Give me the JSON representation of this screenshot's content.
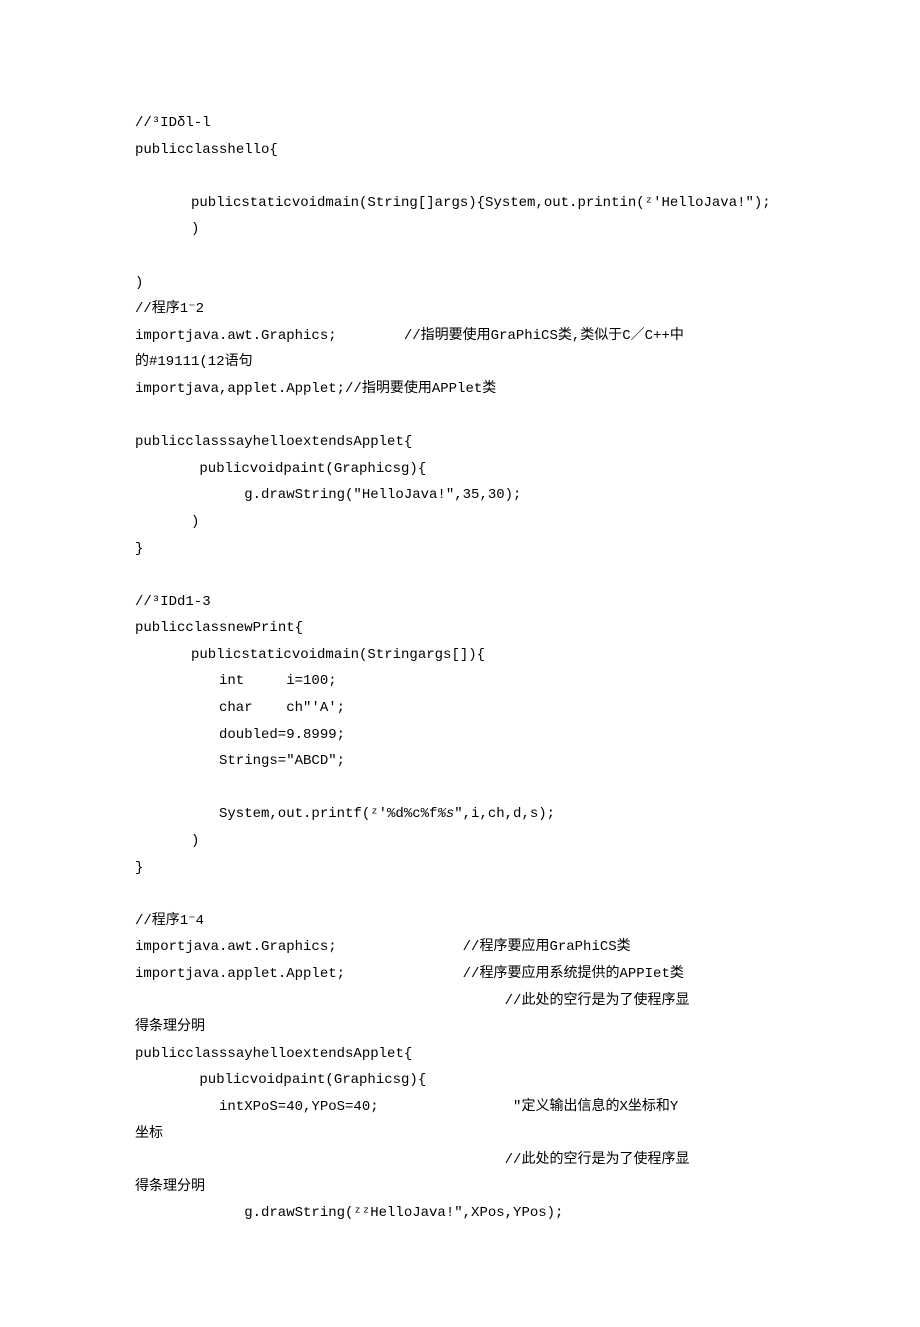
{
  "lines": [
    {
      "cls": "code-line",
      "text": "//³IDδl-l"
    },
    {
      "cls": "code-line",
      "text": "publicclasshello{"
    },
    {
      "cls": "code-line",
      "text": " "
    },
    {
      "cls": "code-line indent1",
      "text": "publicstaticvoidmain(String[]args){System,out.printin(ᶻ'HelloJava!″);"
    },
    {
      "cls": "code-line indent1",
      "text": ")"
    },
    {
      "cls": "code-line",
      "text": " "
    },
    {
      "cls": "code-line",
      "text": ")"
    },
    {
      "cls": "code-line",
      "text": "//程序1⁻2"
    },
    {
      "cls": "code-line",
      "text": "importjava.awt.Graphics;        //指明要使用GraPhiCS类,类似于C／C++中"
    },
    {
      "cls": "code-line",
      "text": "的#19111(12语句"
    },
    {
      "cls": "code-line",
      "text": "importjava,applet.Applet;//指明要使用APPlet类"
    },
    {
      "cls": "code-line",
      "text": " "
    },
    {
      "cls": "code-line",
      "text": "publicclasssayhelloextendsApplet{"
    },
    {
      "cls": "code-line indent1",
      "text": " publicvoidpaint(Graphicsg){"
    },
    {
      "cls": "code-line indent2",
      "text": "   g.drawString(″HelloJava!″,35,30);"
    },
    {
      "cls": "code-line indent1",
      "text": ")"
    },
    {
      "cls": "code-line",
      "text": "}"
    },
    {
      "cls": "code-line",
      "text": " "
    },
    {
      "cls": "code-line",
      "text": "//³IDd1-3"
    },
    {
      "cls": "code-line",
      "text": "publicclassnewPrint{"
    },
    {
      "cls": "code-line indent1",
      "text": "publicstaticvoidmain(Stringargs[]){"
    },
    {
      "cls": "code-line indent2",
      "text": "int     i=100;"
    },
    {
      "cls": "code-line indent2",
      "text": "char    ch″'A';"
    },
    {
      "cls": "code-line indent2",
      "text": "doubled=9.8999;"
    },
    {
      "cls": "code-line indent2",
      "text": "Strings=″ABCD″;"
    },
    {
      "cls": "code-line",
      "text": " "
    },
    {
      "cls": "code-line indent2",
      "text": "System,out.printf(ᶻ'%d%c%f%s″,i,ch,d,s);",
      "special": true
    },
    {
      "cls": "code-line indent1",
      "text": ")"
    },
    {
      "cls": "code-line",
      "text": "}"
    },
    {
      "cls": "code-line",
      "text": " "
    },
    {
      "cls": "code-line",
      "text": "//程序1⁻4"
    },
    {
      "cls": "code-line",
      "text": "importjava.awt.Graphics;               //程序要应用GraPhiCS类"
    },
    {
      "cls": "code-line",
      "text": "importjava.applet.Applet;              //程序要应用系统提供的APPIet类"
    },
    {
      "cls": "code-line",
      "text": "                                            //此处的空行是为了使程序显"
    },
    {
      "cls": "code-line",
      "text": "得条理分明"
    },
    {
      "cls": "code-line",
      "text": "publicclasssayhelloextendsApplet{"
    },
    {
      "cls": "code-line indent1",
      "text": " publicvoidpaint(Graphicsg){"
    },
    {
      "cls": "code-line indent2",
      "text": "intXPoS=40,YPoS=40;                ″定义输出信息的X坐标和Y"
    },
    {
      "cls": "code-line",
      "text": "坐标"
    },
    {
      "cls": "code-line",
      "text": "                                            //此处的空行是为了使程序显"
    },
    {
      "cls": "code-line",
      "text": "得条理分明"
    },
    {
      "cls": "code-line indent2",
      "text": "   g.drawString(ᶻᶻHelloJava!″,XPos,YPos);"
    }
  ]
}
